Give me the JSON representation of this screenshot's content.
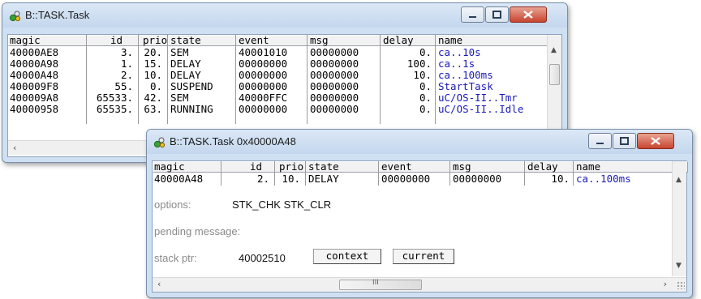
{
  "window1": {
    "title": "B::TASK.Task",
    "columns": [
      "magic",
      "id",
      "prio",
      "state",
      "event",
      "msg",
      "delay",
      "name"
    ],
    "rows": [
      {
        "magic": "40000AE8",
        "id": "3.",
        "prio": "20.",
        "state": "SEM",
        "event": "40001010",
        "msg": "00000000",
        "delay": "0.",
        "name": "ca..10s"
      },
      {
        "magic": "40000A98",
        "id": "1.",
        "prio": "15.",
        "state": "DELAY",
        "event": "00000000",
        "msg": "00000000",
        "delay": "100.",
        "name": "ca..1s"
      },
      {
        "magic": "40000A48",
        "id": "2.",
        "prio": "10.",
        "state": "DELAY",
        "event": "00000000",
        "msg": "00000000",
        "delay": "10.",
        "name": "ca..100ms"
      },
      {
        "magic": "400009F8",
        "id": "55.",
        "prio": "0.",
        "state": "SUSPEND",
        "event": "00000000",
        "msg": "00000000",
        "delay": "0.",
        "name": "StartTask"
      },
      {
        "magic": "400009A8",
        "id": "65533.",
        "prio": "42.",
        "state": "SEM",
        "event": "40000FFC",
        "msg": "00000000",
        "delay": "0.",
        "name": "uC/OS-II..Tmr"
      },
      {
        "magic": "40000958",
        "id": "65535.",
        "prio": "63.",
        "state": "RUNNING",
        "event": "00000000",
        "msg": "00000000",
        "delay": "0.",
        "name": "uC/OS-II..Idle"
      }
    ]
  },
  "window2": {
    "title": "B::TASK.Task 0x40000A48",
    "columns": [
      "magic",
      "id",
      "prio",
      "state",
      "event",
      "msg",
      "delay",
      "name"
    ],
    "row": {
      "magic": "40000A48",
      "id": "2.",
      "prio": "10.",
      "state": "DELAY",
      "event": "00000000",
      "msg": "00000000",
      "delay": "10.",
      "name": "ca..100ms"
    },
    "options_label": "options:",
    "options_value": "STK_CHK STK_CLR",
    "pending_label": "pending message:",
    "stack_label": "stack ptr:",
    "stack_value": "40002510",
    "context_button": "context",
    "current_button": "current",
    "hscroll_thumb_glyph": "III"
  },
  "colors": {
    "blue_name": "#1a1ab8",
    "close_red": "#c7452f",
    "title_gradient_top": "#dbe8f6"
  }
}
